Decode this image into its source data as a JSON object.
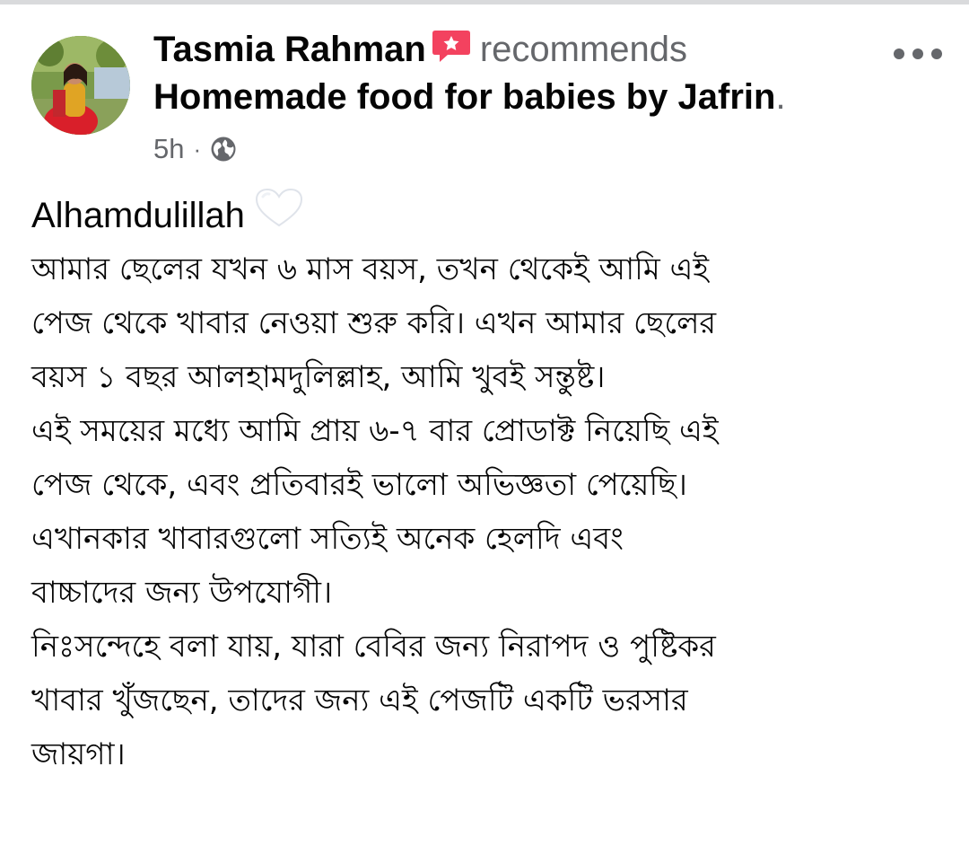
{
  "post": {
    "author": "Tasmia Rahman",
    "recommends_label": "recommends",
    "page_name": "Homemade food for babies by Jafrin",
    "page_name_suffix": ".",
    "timestamp": "5h",
    "separator": "·",
    "privacy_icon": "globe-icon",
    "more_icon": "more-options-icon",
    "recommend_icon": "recommend-badge-icon",
    "first_line": "Alhamdulillah",
    "heart_icon": "white-heart-icon",
    "lines": [
      "আমার ছেলের যখন ৬ মাস বয়স, তখন থেকেই আমি এই",
      "পেজ থেকে খাবার নেওয়া শুরু করি। এখন আমার ছেলের",
      "বয়স ১ বছর  আলহামদুলিল্লাহ, আমি খুবই সন্তুষ্ট।",
      "এই সময়ের মধ্যে আমি প্রায় ৬-৭ বার প্রোডাক্ট নিয়েছি এই",
      "পেজ থেকে, এবং প্রতিবারই ভালো অভিজ্ঞতা পেয়েছি।",
      "এখানকার খাবারগুলো সত্যিই অনেক হেলদি এবং",
      "বাচ্চাদের জন্য উপযোগী।",
      "নিঃসন্দেহে বলা যায়, যারা বেবির জন্য নিরাপদ ও পুষ্টিকর",
      "খাবার খুঁজছেন, তাদের জন্য এই পেজটি একটি ভরসার",
      "জায়গা।"
    ]
  },
  "colors": {
    "text_primary": "#050505",
    "text_secondary": "#65676b",
    "recommend_badge": "#f3425f"
  }
}
